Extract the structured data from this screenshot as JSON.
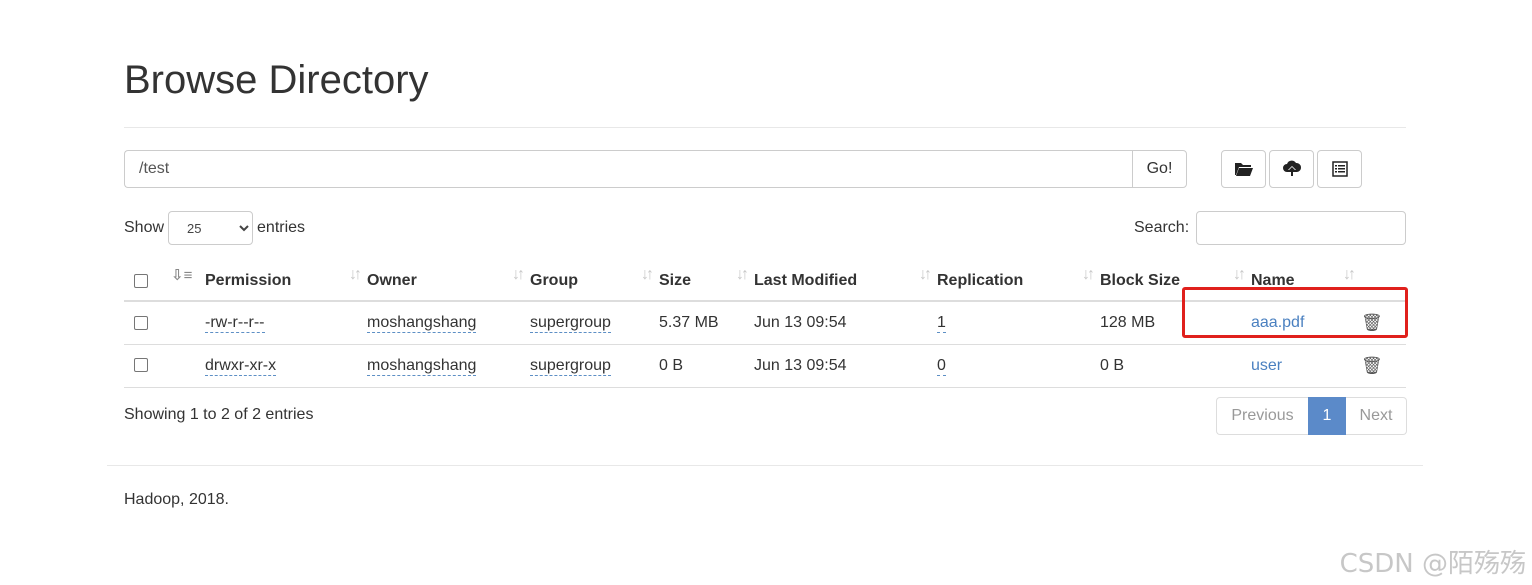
{
  "page": {
    "title": "Browse Directory"
  },
  "path_bar": {
    "value": "/test",
    "go_label": "Go!"
  },
  "toolbar": {
    "icons": [
      "folder-open-icon",
      "cloud-upload-icon",
      "list-alt-icon"
    ]
  },
  "length": {
    "show_label": "Show",
    "entries_label": "entries",
    "selected": "25"
  },
  "search": {
    "label": "Search:",
    "value": ""
  },
  "table": {
    "columns": [
      "Permission",
      "Owner",
      "Group",
      "Size",
      "Last Modified",
      "Replication",
      "Block Size",
      "Name"
    ],
    "rows": [
      {
        "permission": "-rw-r--r--",
        "owner": "moshangshang",
        "group": "supergroup",
        "size": "5.37 MB",
        "modified": "Jun 13 09:54",
        "replication": "1",
        "block_size": "128 MB",
        "name": "aaa.pdf"
      },
      {
        "permission": "drwxr-xr-x",
        "owner": "moshangshang",
        "group": "supergroup",
        "size": "0 B",
        "modified": "Jun 13 09:54",
        "replication": "0",
        "block_size": "0 B",
        "name": "user"
      }
    ]
  },
  "info": {
    "text": "Showing 1 to 2 of 2 entries"
  },
  "pagination": {
    "previous": "Previous",
    "current": "1",
    "next": "Next"
  },
  "footer": {
    "text": "Hadoop, 2018."
  },
  "watermark": {
    "text": "CSDN @陌殇殇"
  },
  "colors": {
    "link": "#4a80c0",
    "active_page": "#5b8ac9",
    "highlight": "#e0201c"
  }
}
